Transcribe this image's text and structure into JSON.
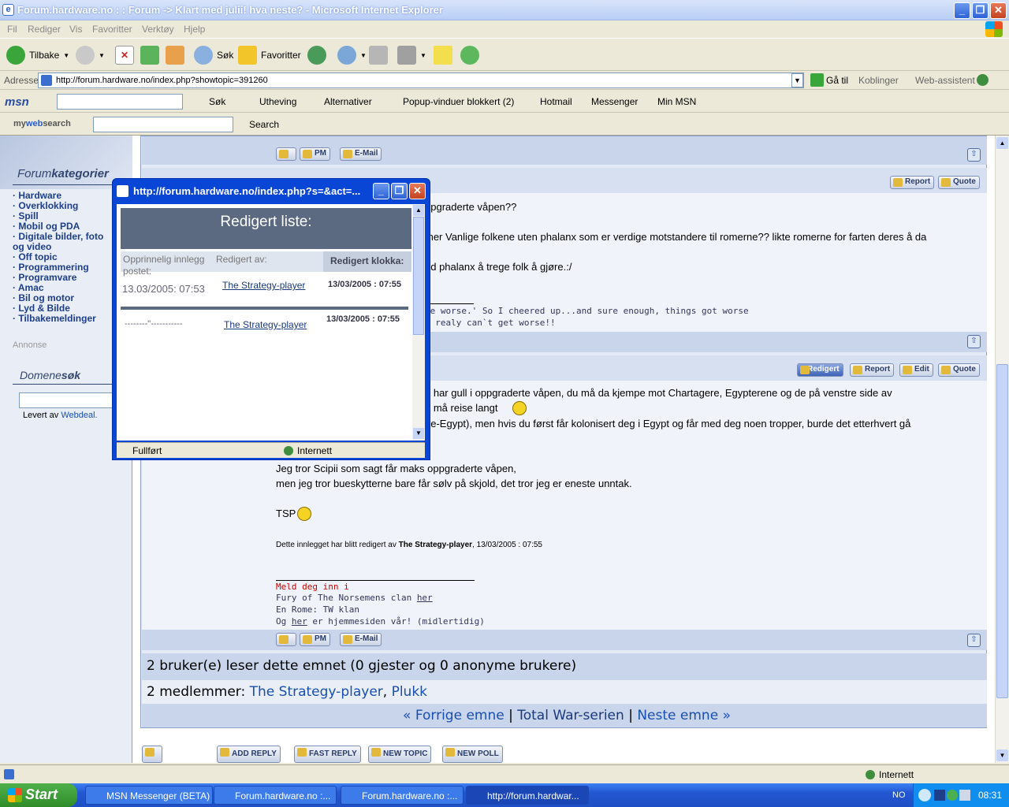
{
  "window": {
    "title": "Forum.hardware.no : : Forum -> Klart med julii! hva neste? - Microsoft Internet Explorer"
  },
  "menu": [
    "Fil",
    "Rediger",
    "Vis",
    "Favoritter",
    "Verktøy",
    "Hjelp"
  ],
  "toolbar": {
    "back": "Tilbake",
    "search": "Søk",
    "favorites": "Favoritter"
  },
  "address": {
    "label": "Adresse",
    "url": "http://forum.hardware.no/index.php?showtopic=391260",
    "go": "Gå til",
    "links": "Koblinger",
    "webassist": "Web-assistent"
  },
  "msn": {
    "logo": "msn",
    "search": "Søk",
    "highlight": "Utheving",
    "alternatives": "Alternativer",
    "popup": "Popup-vinduer blokkert (2)",
    "hotmail": "Hotmail",
    "messenger": "Messenger",
    "mymsn": "Min MSN"
  },
  "myweb": {
    "logo_my": "my",
    "logo_web": "web",
    "logo_search": "search",
    "search": "Search"
  },
  "sidebar": {
    "title_a": "Forum",
    "title_b": "kategorier",
    "items": [
      "· Hardware",
      "· Overklokking",
      "· Spill",
      "· Mobil og PDA",
      "· Digitale bilder, foto",
      "og video",
      "· Off topic",
      "· Programmering",
      "· Programvare",
      "· Amac",
      "· Bil og motor",
      "· Lyd & Bilde",
      "· Tilbakemeldinger"
    ],
    "annonse": "Annonse",
    "domain_a": "Domene",
    "domain_b": "søk",
    "levert": "Levert av ",
    "webdeal": "Webdeal."
  },
  "buttons": {
    "pm": "PM",
    "email": "E-Mail",
    "report": "Report",
    "quote": "Quote",
    "edit": "Edit",
    "redigert": "Redigert"
  },
  "post1": {
    "line1": "ppgraderte våpen??",
    "line2": "mer Vanlige folkene uten phalanx som er verdige motstandere til romerne?? likte romerne for farten deres å da",
    "line3": "ed phalanx å trege folk å gjøre.:/",
    "sig1": "be worse.' So I cheered up...and sure enough, things got worse",
    "sig2": "t realy can`t get worse!!"
  },
  "post2": {
    "line1": "n har gull i oppgraderte våpen, du må da kjempe mot Chartagere, Egypterene og de på venstre side av",
    "line2": "u må reise langt",
    "line3": "ge-Egypt), men hvis du først får kolonisert deg i Egypt og får med deg noen tropper, burde det etterhvert gå",
    "line4": "Jeg tror Scipii som sagt får maks oppgraderte våpen,",
    "line5": "men jeg tror bueskytterne bare får sølv på skjold, det tror jeg er eneste unntak.",
    "tsp": "TSP",
    "edited_prefix": "Dette innlegget har blitt redigert av ",
    "edited_by": "The Strategy-player",
    "edited_time": ", 13/03/2005 : 07:55",
    "sig_red": "Meld deg inn i",
    "sig_a": "Fury of The Norsemens clan ",
    "sig_a_link": "her",
    "sig_b": "En Rome: TW klan",
    "sig_c1": "Og ",
    "sig_c_link": "her",
    "sig_c2": " er hjemmesiden vår! (midlertidig)"
  },
  "readers": {
    "line": "2 bruker(e) leser dette emnet (0 gjester og 0 anonyme brukere)",
    "members_label": "2 medlemmer: ",
    "member1": "The Strategy-player",
    "sep": ", ",
    "member2": "Plukk"
  },
  "nav": {
    "lq": "« ",
    "prev": "Forrige emne",
    "sep1": " | ",
    "series": "Total War-serien",
    "sep2": " | ",
    "next": "Neste emne",
    "rq": " »"
  },
  "actions": {
    "add_reply": "ADD REPLY",
    "fast_reply": "FAST REPLY",
    "new_topic": "NEW TOPIC",
    "new_poll": "NEW POLL"
  },
  "popup": {
    "title": "http://forum.hardware.no/index.php?s=&act=...",
    "heading": "Redigert liste:",
    "col1": "Opprinnelig innlegg postet:",
    "col2": "Redigert av:",
    "col3": "Redigert klokka:",
    "row1_date": "13.03/2005: 07:53",
    "row1_by": "The Strategy-player",
    "row1_time": "13/03/2005 : 07:55",
    "row2_date": "--------\"-----------",
    "row2_by": "The Strategy-player",
    "row2_time": "13/03/2005 : 07:55",
    "status": "Fullført",
    "zone": "Internett"
  },
  "status": {
    "zone": "Internett"
  },
  "taskbar": {
    "start": "Start",
    "tasks": [
      "MSN Messenger (BETA)",
      "Forum.hardware.no :...",
      "Forum.hardware.no :...",
      "http://forum.hardwar..."
    ],
    "lang": "NO",
    "clock": "08:31"
  }
}
